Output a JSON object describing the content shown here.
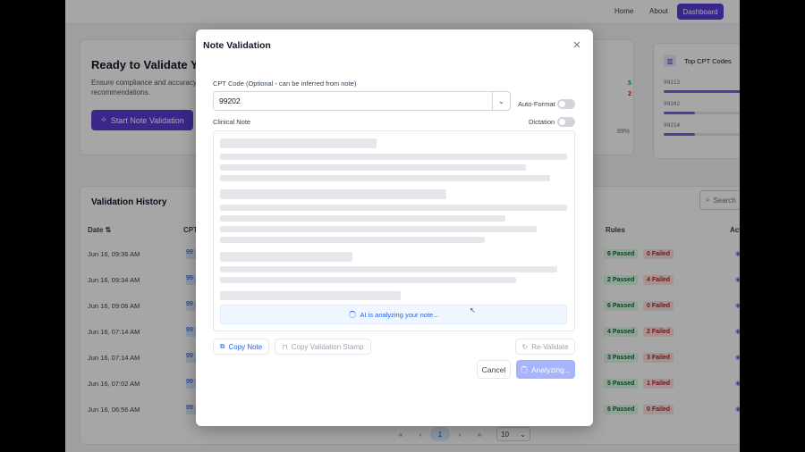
{
  "nav": {
    "home": "Home",
    "about": "About",
    "dashboard": "Dashboard"
  },
  "hero": {
    "title": "Ready to Validate Yo",
    "subtitle": "Ensure compliance and accuracy recommendations.",
    "start_button": "Start Note Validation",
    "stat_pass": "5",
    "stat_fail": "2",
    "percent": "89%"
  },
  "top_cpt": {
    "title": "Top CPT Codes",
    "codes": [
      {
        "code": "99213",
        "share": 0.95
      },
      {
        "code": "99202",
        "share": 0.35
      },
      {
        "code": "99214",
        "share": 0.35
      }
    ]
  },
  "history": {
    "title": "Validation History",
    "search_placeholder": "Search",
    "columns": {
      "date": "Date",
      "cpt": "CPT",
      "rules": "Rules",
      "actions": "Act"
    },
    "rows": [
      {
        "date": "Jun 16, 09:36 AM",
        "cpt": "99",
        "passed": "6 Passed",
        "failed": "0 Failed"
      },
      {
        "date": "Jun 16, 09:34 AM",
        "cpt": "99",
        "passed": "2 Passed",
        "failed": "4 Failed"
      },
      {
        "date": "Jun 16, 09:06 AM",
        "cpt": "99",
        "passed": "6 Passed",
        "failed": "0 Failed"
      },
      {
        "date": "Jun 16, 07:14 AM",
        "cpt": "99",
        "passed": "4 Passed",
        "failed": "2 Failed"
      },
      {
        "date": "Jun 16, 07:14 AM",
        "cpt": "99",
        "passed": "3 Passed",
        "failed": "3 Failed"
      },
      {
        "date": "Jun 16, 07:02 AM",
        "cpt": "99",
        "passed": "5 Passed",
        "failed": "1 Failed"
      },
      {
        "date": "Jun 16, 06:56 AM",
        "cpt": "99",
        "passed": "6 Passed",
        "failed": "0 Failed"
      }
    ]
  },
  "pagination": {
    "first": "«",
    "prev": "‹",
    "current": "1",
    "next": "›",
    "last": "»",
    "page_size": "10"
  },
  "modal": {
    "title": "Note Validation",
    "close": "✕",
    "cpt_label": "CPT Code (Optional - can be inferred from note)",
    "cpt_value": "99202",
    "auto_format_label": "Auto-Format",
    "dictation_label": "Dictation",
    "note_label": "Clinical Note",
    "analyzing_text": "AI is analyzing your note...",
    "copy_note": "Copy Note",
    "copy_stamp": "Copy Validation Stamp",
    "revalidate": "Re-Validate",
    "cancel": "Cancel",
    "analyzing_button": "Analyzing..."
  }
}
